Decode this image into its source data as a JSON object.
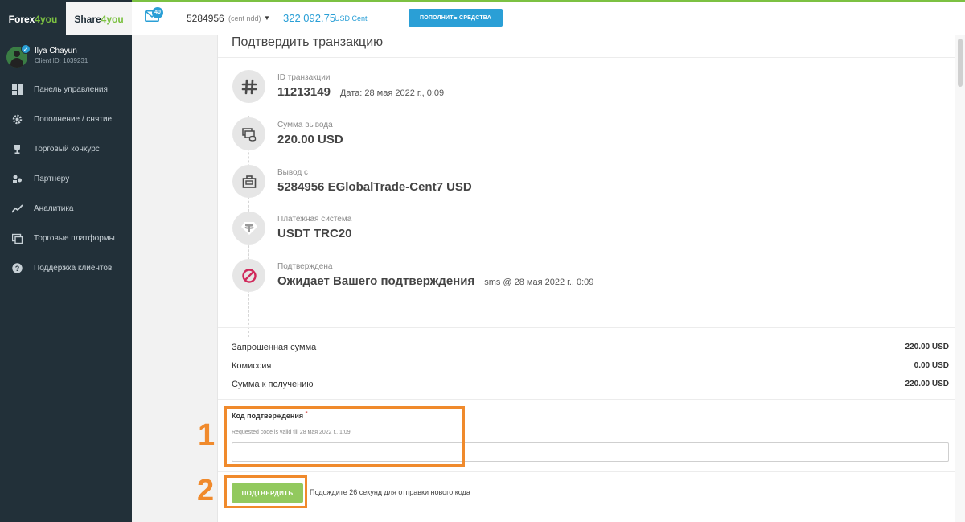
{
  "brand": {
    "forex_prefix": "Forex",
    "forex_suffix": "4you",
    "share_prefix": "Share",
    "share_suffix": "4you"
  },
  "user": {
    "name": "Ilya Chayun",
    "client_id": "Client ID: 1039231"
  },
  "sidebar": {
    "items": [
      {
        "label": "Панель управления",
        "icon": "dashboard-icon"
      },
      {
        "label": "Пополнение / снятие",
        "icon": "gear-icon"
      },
      {
        "label": "Торговый конкурс",
        "icon": "trophy-icon"
      },
      {
        "label": "Партнеру",
        "icon": "partner-icon"
      },
      {
        "label": "Аналитика",
        "icon": "chart-line-icon"
      },
      {
        "label": "Торговые платформы",
        "icon": "platforms-icon"
      },
      {
        "label": "Поддержка клиентов",
        "icon": "help-icon"
      }
    ]
  },
  "header": {
    "mail_count": "40",
    "account_number": "5284956",
    "account_type": "(cent ndd)",
    "balance": "322 092.75",
    "currency": "USD Cent",
    "deposit_label": "ПОПОЛНИТЬ СРЕДСТВА"
  },
  "transaction": {
    "title": "Подтвердить транзакцию",
    "steps": [
      {
        "label": "ID транзакции",
        "value": "11213149",
        "extra": "Дата: 28 мая 2022 г., 0:09",
        "icon": "hash-icon"
      },
      {
        "label": "Сумма вывода",
        "value": "220.00 USD",
        "extra": "",
        "icon": "money-icon"
      },
      {
        "label": "Вывод с",
        "value": "5284956 EGlobalTrade-Cent7 USD",
        "extra": "",
        "icon": "briefcase-icon"
      },
      {
        "label": "Платежная система",
        "value": "USDT TRC20",
        "extra": "",
        "icon": "tether-icon"
      },
      {
        "label": "Подтверждена",
        "value": "Ожидает Вашего подтверждения",
        "extra": "sms @ 28 мая 2022 г., 0:09",
        "icon": "blocked-icon"
      }
    ],
    "summary": [
      {
        "label": "Запрошенная сумма",
        "value": "220.00 USD"
      },
      {
        "label": "Комиссия",
        "value": "0.00 USD"
      },
      {
        "label": "Сумма к получению",
        "value": "220.00 USD"
      }
    ],
    "code_label": "Код подтверждения",
    "code_required": "*",
    "code_hint": "Requested code is valid till 28 мая 2022 г., 1:09",
    "code_value": "",
    "confirm_label": "ПОДТВЕРДИТЬ",
    "wait_text": "Подождите 26 секунд для отправки нового кода"
  },
  "annotations": {
    "one": "1",
    "two": "2",
    "color": "#f08a2c"
  },
  "colors": {
    "sidebar": "#223039",
    "accent_green": "#7cc142",
    "accent_blue": "#2a9fd6",
    "confirm_green": "#92c95e"
  }
}
